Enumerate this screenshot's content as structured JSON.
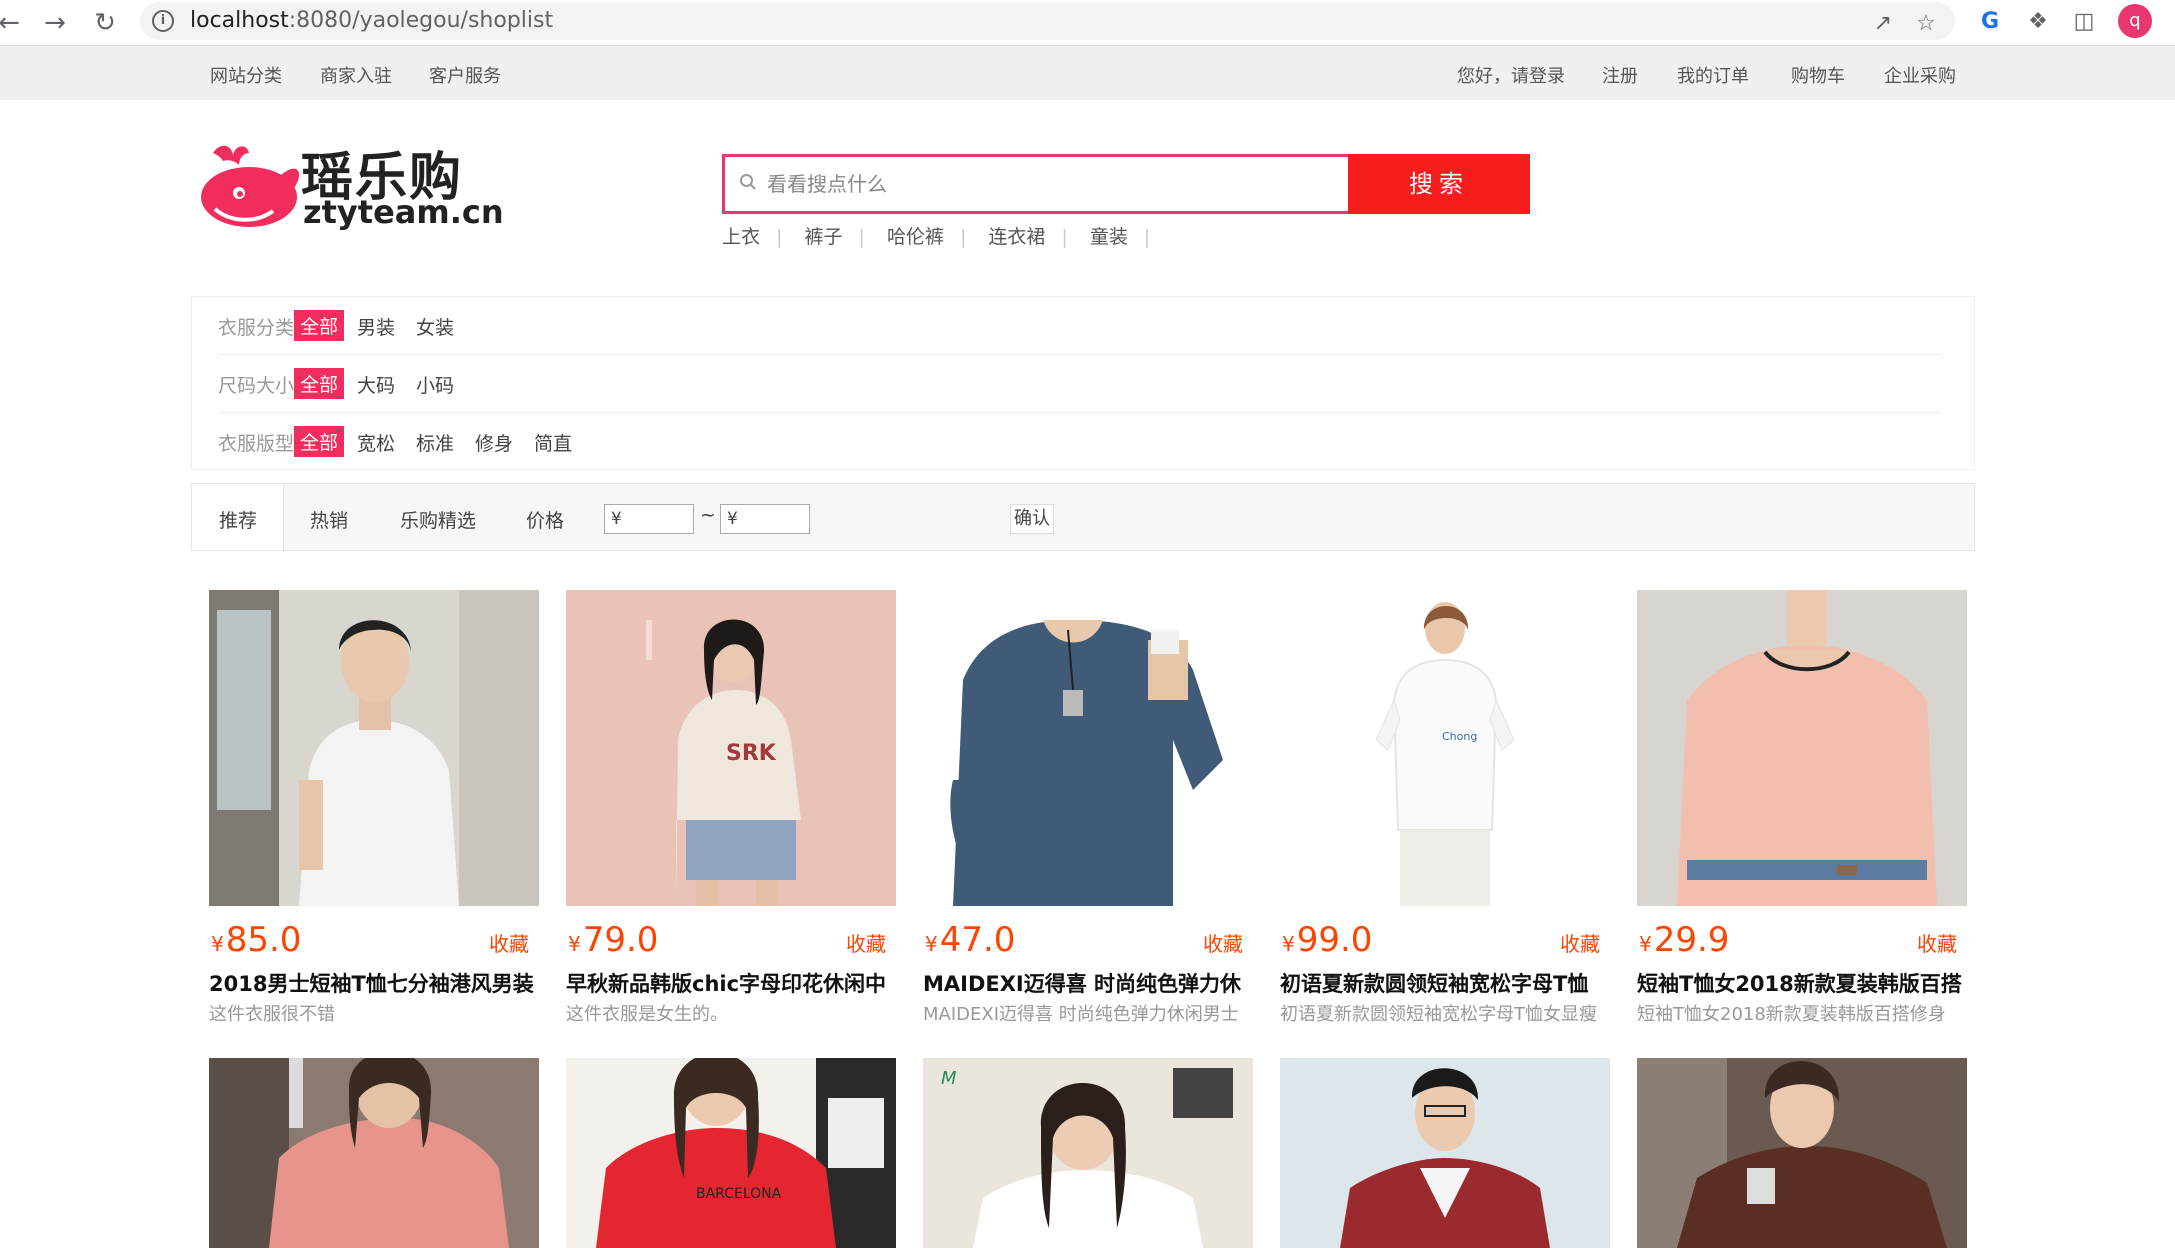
{
  "browser": {
    "url_host": "localhost",
    "url_rest": ":8080/yaolegou/shoplist",
    "profile_initial": "q"
  },
  "topbar": {
    "left": [
      "网站分类",
      "商家入驻",
      "客户服务"
    ],
    "right": [
      "您好，请登录",
      "注册",
      "我的订单",
      "购物车",
      "企业采购"
    ]
  },
  "logo": {
    "name": "瑶乐购",
    "domain": "ztyteam.cn"
  },
  "search": {
    "placeholder": "看看搜点什么",
    "button": "搜索",
    "hotwords": [
      "上衣",
      "裤子",
      "哈伦裤",
      "连衣裙",
      "童装"
    ]
  },
  "filters": [
    {
      "label": "衣服分类:",
      "options": [
        "全部",
        "男装",
        "女装"
      ],
      "selected": 0
    },
    {
      "label": "尺码大小:",
      "options": [
        "全部",
        "大码",
        "小码"
      ],
      "selected": 0
    },
    {
      "label": "衣服版型:",
      "options": [
        "全部",
        "宽松",
        "标准",
        "修身",
        "简直"
      ],
      "selected": 0
    }
  ],
  "sort": {
    "tabs": [
      "推荐",
      "热销",
      "乐购精选",
      "价格"
    ],
    "price_from": "¥",
    "price_sep": "~",
    "price_to": "¥",
    "confirm": "确认"
  },
  "products": [
    {
      "yen": "¥",
      "price": "85.0",
      "fav": "收藏",
      "name": "2018男士短袖T恤七分袖港风男装",
      "desc": "这件衣服很不错",
      "img": "man-white-tee"
    },
    {
      "yen": "¥",
      "price": "79.0",
      "fav": "收藏",
      "name": "早秋新品韩版chic字母印花休闲中",
      "desc": "这件衣服是女生的。",
      "img": "woman-letter-sweatshirt"
    },
    {
      "yen": "¥",
      "price": "47.0",
      "fav": "收藏",
      "name": "MAIDEXI迈得喜 时尚纯色弹力休",
      "desc": "MAIDEXI迈得喜 时尚纯色弹力休闲男士",
      "img": "man-blue-longsleeve"
    },
    {
      "yen": "¥",
      "price": "99.0",
      "fav": "收藏",
      "name": "初语夏新款圆领短袖宽松字母T恤",
      "desc": "初语夏新款圆领短袖宽松字母T恤女显瘦",
      "img": "woman-white-tee"
    },
    {
      "yen": "¥",
      "price": "29.9",
      "fav": "收藏",
      "name": "短袖T恤女2018新款夏装韩版百搭",
      "desc": "短袖T恤女2018新款夏装韩版百搭修身",
      "img": "woman-pink-tee"
    }
  ],
  "products_row2": [
    {
      "img": "woman-pink-sweater"
    },
    {
      "img": "woman-red-tee"
    },
    {
      "img": "woman-white-vneck"
    },
    {
      "img": "man-red-jacket"
    },
    {
      "img": "man-brown-leather-jacket"
    }
  ]
}
